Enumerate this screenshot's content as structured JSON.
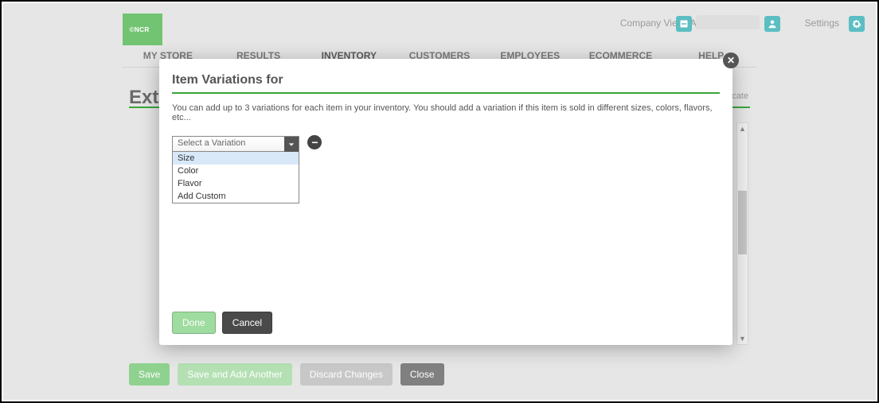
{
  "header": {
    "company_view": "Company View (All Stores)",
    "settings": "Settings"
  },
  "nav": {
    "items": [
      "MY STORE",
      "RESULTS",
      "INVENTORY",
      "CUSTOMERS",
      "EMPLOYEES",
      "ECOMMERCE",
      "HELP"
    ],
    "active_index": 2
  },
  "page": {
    "title_fragment": "Ext",
    "side_link": "icate",
    "buttons": {
      "save": "Save",
      "save_add": "Save and Add Another",
      "discard": "Discard Changes",
      "close": "Close"
    }
  },
  "modal": {
    "title": "Item Variations for",
    "description": "You can add up to 3 variations for each item in your inventory. You should add a variation if this item is sold in different sizes, colors, flavors, etc...",
    "select": {
      "placeholder": "Select a Variation",
      "options": [
        "Size",
        "Color",
        "Flavor",
        "Add Custom"
      ],
      "highlighted_index": 0
    },
    "buttons": {
      "done": "Done",
      "cancel": "Cancel"
    }
  },
  "colors": {
    "accent_green": "#3aa63a",
    "brand_green": "#72c472",
    "teal_icon": "#5bbec2"
  }
}
